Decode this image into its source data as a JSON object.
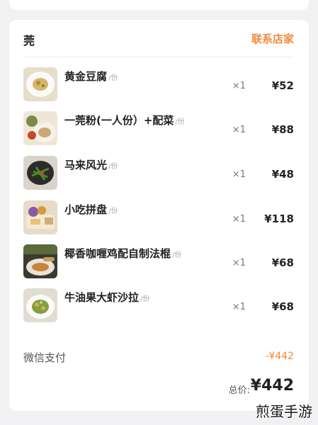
{
  "shop": {
    "name": "莞",
    "contact_label": "联系店家"
  },
  "items": [
    {
      "title": "黄金豆腐",
      "unit": "/份",
      "qty": "×1",
      "price": "¥52"
    },
    {
      "title": "一莞粉(一人份）+配菜",
      "unit": "/份",
      "qty": "×1",
      "price": "¥88"
    },
    {
      "title": "马来风光",
      "unit": "/份",
      "qty": "×1",
      "price": "¥48"
    },
    {
      "title": "小吃拼盘",
      "unit": "/份",
      "qty": "×1",
      "price": "¥118"
    },
    {
      "title": "椰香咖喱鸡配自制法棍",
      "unit": "/份",
      "qty": "×1",
      "price": "¥68"
    },
    {
      "title": "牛油果大虾沙拉",
      "unit": "/份",
      "qty": "×1",
      "price": "¥68"
    }
  ],
  "payment": {
    "label": "微信支付",
    "amount": "-¥442"
  },
  "total": {
    "label": "总价:",
    "amount": "¥442"
  },
  "watermark": "煎蛋手游",
  "colors": {
    "accent": "#f08a3c",
    "background": "#f1f1f3",
    "card": "#ffffff"
  },
  "icons": [
    "dish-photo"
  ]
}
